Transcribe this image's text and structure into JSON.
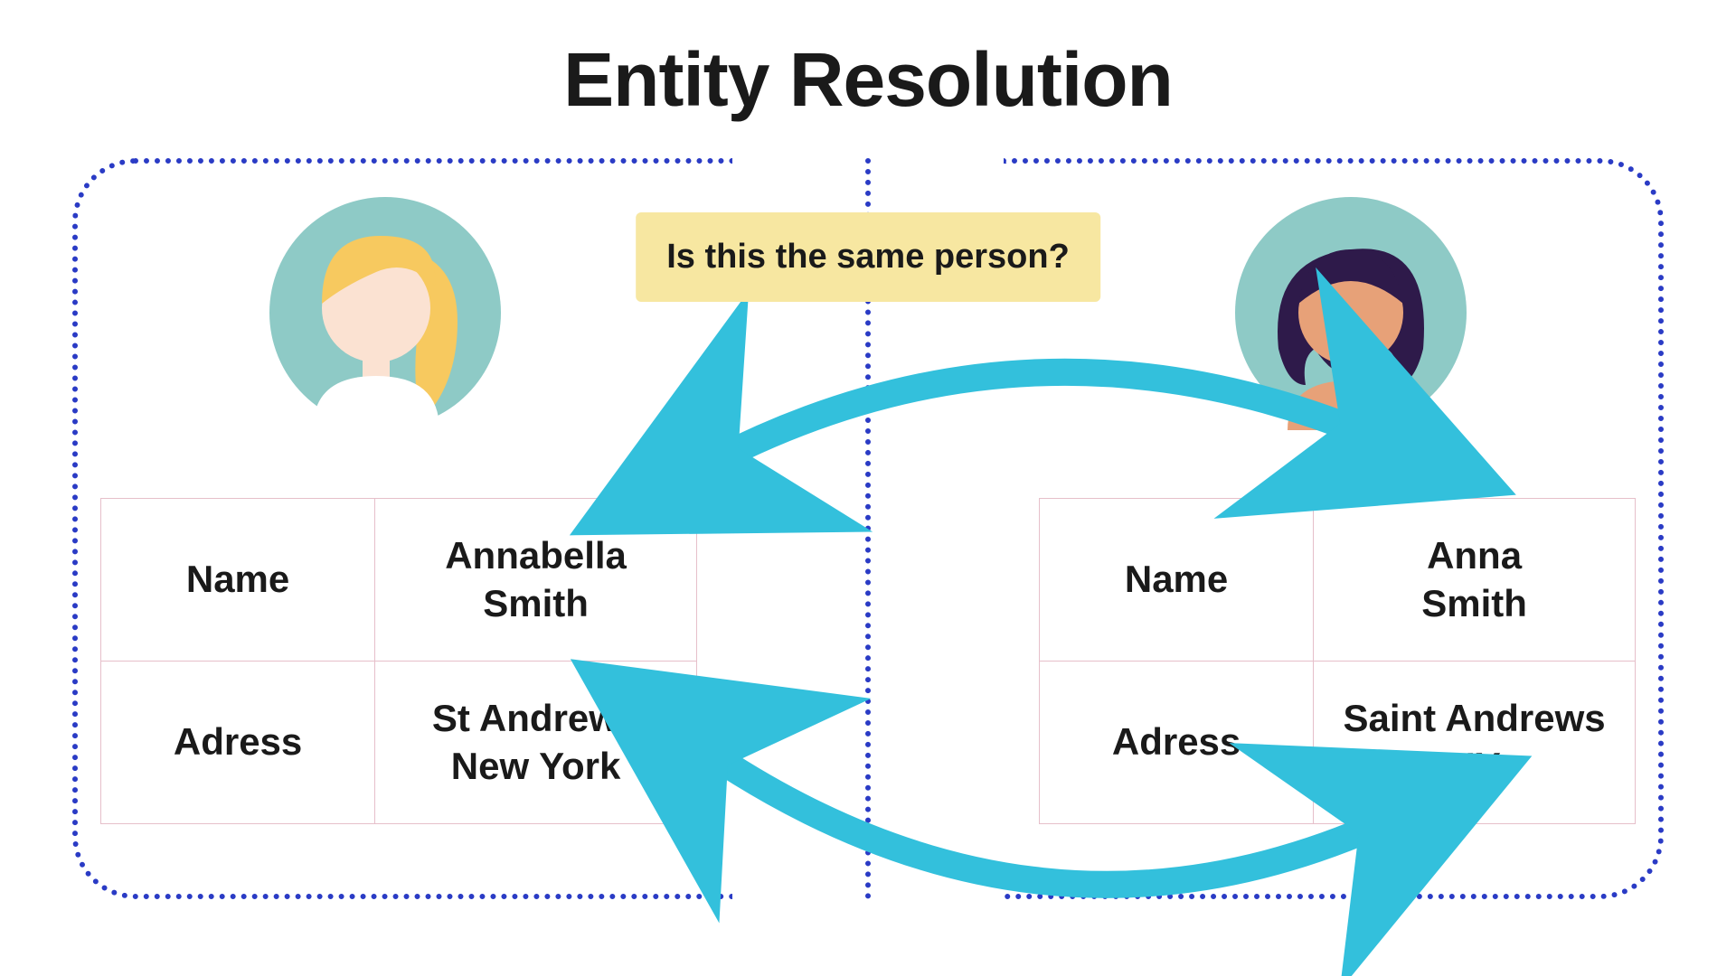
{
  "title": "Entity Resolution",
  "question": "Is this the same person?",
  "left": {
    "name_label": "Name",
    "name_value": "Annabella\nSmith",
    "address_label": "Adress",
    "address_value": "St Andrews\nNew York"
  },
  "right": {
    "name_label": "Name",
    "name_value": "Anna\nSmith",
    "address_label": "Adress",
    "address_value": "Saint Andrews\nNY"
  },
  "colors": {
    "arrow": "#33c0dc",
    "dot_border": "#2a3bc5",
    "highlight": "#f7e7a1",
    "avatar_bg": "#8ecac6",
    "hair_left": "#f7c95f",
    "skin_left": "#fbe2d2",
    "hair_right": "#2e1a4a",
    "skin_right": "#e7a178"
  }
}
